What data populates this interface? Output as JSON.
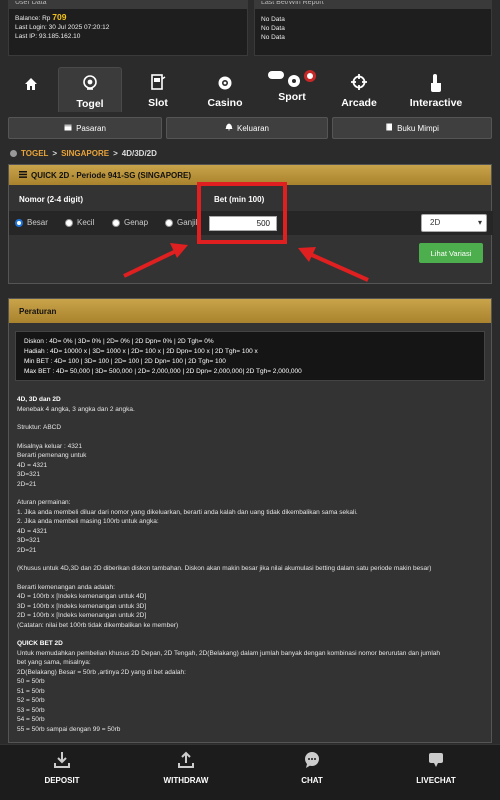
{
  "user_card": {
    "header": "User Data",
    "balance_label": "Balance: Rp",
    "balance_value": "709",
    "last_login": "Last Login: 30 Jul 2025 07:20:12",
    "last_ip": "Last IP: 93.185.162.10"
  },
  "report_card": {
    "header": "Last Bet/Win Report",
    "lines": [
      "No Data",
      "No Data",
      "No Data"
    ]
  },
  "nav": {
    "items": [
      {
        "label": "",
        "icon": "home-icon"
      },
      {
        "label": "Togel",
        "icon": "lottery-ball-icon",
        "active": true
      },
      {
        "label": "Slot",
        "icon": "slot-machine-icon"
      },
      {
        "label": "Casino",
        "icon": "casino-chip-icon"
      },
      {
        "label": "Sport",
        "icon": "sport-icon"
      },
      {
        "label": "Arcade",
        "icon": "crosshair-icon"
      },
      {
        "label": "Interactive",
        "icon": "touch-icon"
      }
    ]
  },
  "submenu": {
    "pasaran": "Pasaran",
    "keluaran": "Keluaran",
    "buku_mimpi": "Buku Mimpi"
  },
  "breadcrumb": {
    "togel": "TOGEL",
    "sep1": ">",
    "singapore": "SINGAPORE",
    "sep2": ">",
    "current": "4D/3D/2D"
  },
  "quick_panel": {
    "title": "QUICK 2D - Periode 941-SG (SINGAPORE)",
    "nomor_label": "Nomor (2-4 digit)",
    "bet_label": "Bet (min 100)",
    "options": [
      "Besar",
      "Kecil",
      "Genap",
      "Ganjil"
    ],
    "selected_option": "Besar",
    "bet_value": "500",
    "type_select": "2D",
    "view_button": "Lihat Variasi"
  },
  "rules": {
    "title": "Peraturan",
    "fees": [
      "Diskon : 4D= 0% | 3D= 0% | 2D= 0% | 2D Dpn= 0% | 2D Tgh= 0%",
      "Hadiah : 4D= 10000 x | 3D= 1000 x | 2D= 100 x | 2D Dpn= 100 x | 2D Tgh= 100 x",
      "Min BET : 4D= 100 | 3D= 100 | 2D= 100 | 2D Dpn= 100 | 2D Tgh= 100",
      "Max BET : 4D= 50,000 | 3D= 500,000 | 2D= 2,000,000 | 2D Dpn= 2,000,000| 2D Tgh= 2,000,000"
    ],
    "body": [
      {
        "t": "4D, 3D dan 2D",
        "b": true
      },
      {
        "t": "Menebak 4 angka, 3 angka dan 2 angka."
      },
      {
        "gap": true
      },
      {
        "t": "Struktur: ABCD"
      },
      {
        "gap": true
      },
      {
        "t": "Misalnya keluar : 4321"
      },
      {
        "t": "Berarti pemenang untuk"
      },
      {
        "t": "4D = 4321"
      },
      {
        "t": "3D=321"
      },
      {
        "t": "2D=21"
      },
      {
        "gap": true
      },
      {
        "t": "Aturan permainan:"
      },
      {
        "t": "1. Jika anda membeli diluar dari nomor yang dikeluarkan, berarti anda kalah dan uang tidak dikembalikan sama sekali."
      },
      {
        "t": "2. Jika anda membeli masing 100rb untuk angka:"
      },
      {
        "t": "4D = 4321"
      },
      {
        "t": "3D=321"
      },
      {
        "t": "2D=21"
      },
      {
        "gap": true
      },
      {
        "t": "(Khusus untuk 4D,3D dan 2D diberikan diskon tambahan. Diskon akan makin besar jika nilai akumulasi betting dalam satu periode makin besar)"
      },
      {
        "gap": true
      },
      {
        "t": "Berarti kemenangan anda adalah:"
      },
      {
        "t": "4D = 100rb x [Indeks kemenangan untuk 4D]"
      },
      {
        "t": "3D = 100rb x [Indeks kemenangan untuk 3D]"
      },
      {
        "t": "2D = 100rb x [Indeks kemenangan untuk 2D]"
      },
      {
        "t": "(Catatan: nilai bet 100rb tidak dikembalikan ke member)"
      },
      {
        "gap": true
      },
      {
        "t": "QUICK BET 2D",
        "b": true
      },
      {
        "t": "Untuk memudahkan pembelian khusus 2D Depan, 2D Tengah, 2D(Belakang) dalam jumlah banyak dengan kombinasi nomor berurutan dan jumlah"
      },
      {
        "t": "bet yang sama, misalnya:"
      },
      {
        "t": "2D(Belakang) Besar = 50rb ,artinya 2D yang di bet adalah:"
      },
      {
        "t": "50 = 50rb"
      },
      {
        "t": "51 = 50rb"
      },
      {
        "t": "52 = 50rb"
      },
      {
        "t": "53 = 50rb"
      },
      {
        "t": "54 = 50rb"
      },
      {
        "t": "55 = 50rb sampai dengan 99 = 50rb"
      }
    ]
  },
  "bottom_nav": {
    "deposit": "DEPOSIT",
    "withdraw": "WITHDRAW",
    "chat": "CHAT",
    "livechat": "LIVECHAT"
  },
  "colors": {
    "accent_gold": "#c9a44a",
    "balance_yellow": "#f5c518",
    "annotation_red": "#e02020",
    "button_green": "#4cae4c",
    "breadcrumb_link": "#e8a33a"
  }
}
